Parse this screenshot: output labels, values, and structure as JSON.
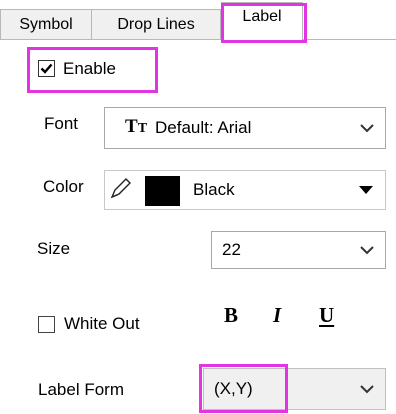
{
  "tabs": [
    {
      "label": "Symbol",
      "active": false
    },
    {
      "label": "Drop Lines",
      "active": false
    },
    {
      "label": "Label",
      "active": true
    }
  ],
  "enable": {
    "label": "Enable",
    "checked": true
  },
  "font": {
    "label": "Font",
    "value": "Default: Arial",
    "icon": "font-truetype-icon"
  },
  "color": {
    "label": "Color",
    "value": "Black",
    "swatch": "#000000",
    "icon": "pen-icon"
  },
  "size": {
    "label": "Size",
    "value": "22"
  },
  "white_out": {
    "label": "White Out",
    "checked": false
  },
  "format_buttons": {
    "bold": "B",
    "italic": "I",
    "underline": "U"
  },
  "label_form": {
    "label": "Label Form",
    "value": "(X,Y)"
  },
  "colors": {
    "highlight": "#e234e2",
    "tab_border": "#b8b8b8",
    "combo_bg_disabled": "#f0f0f0"
  }
}
